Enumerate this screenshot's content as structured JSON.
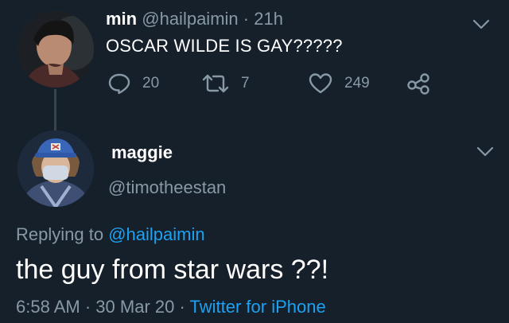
{
  "tweet1": {
    "display_name": "min",
    "handle": "@hailpaimin",
    "separator": "·",
    "time": "21h",
    "text": "OSCAR WILDE IS GAY?????",
    "actions": {
      "replies": "20",
      "retweets": "7",
      "likes": "249"
    }
  },
  "tweet2": {
    "display_name": "maggie",
    "handle": "@timotheestan",
    "replying_prefix": "Replying to",
    "replying_to": "@hailpaimin",
    "text": "the guy from star wars ??!",
    "time": "6:58 AM",
    "date": "30 Mar 20",
    "separator": "·",
    "source": "Twitter for iPhone"
  },
  "icons": {
    "reply": "reply-icon",
    "retweet": "retweet-icon",
    "like": "heart-icon",
    "share": "share-icon",
    "menu": "chevron-down-icon"
  },
  "colors": {
    "background": "#15202b",
    "text": "#ffffff",
    "muted": "#8899a6",
    "accent": "#1da1f2"
  }
}
